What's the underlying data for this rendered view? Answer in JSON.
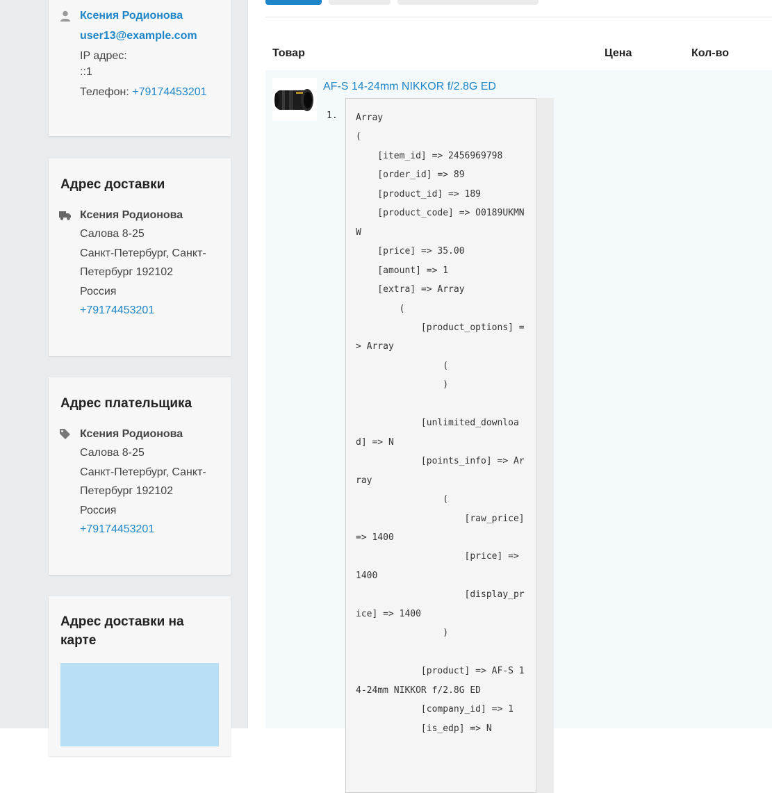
{
  "colors": {
    "accent": "#1e86c8",
    "sidebar_bg": "#e9ecef",
    "card_bg": "#f7f7f7",
    "map_bg": "#b9dff6"
  },
  "customer": {
    "name": "Ксения Родионова",
    "email": "user13@example.com",
    "ip_label": "IP адрес:",
    "ip_value": "::1",
    "phone_label": "Телефон:",
    "phone_value": "+79174453201",
    "icon": "user-icon"
  },
  "shipping": {
    "title": "Адрес доставки",
    "icon": "truck-icon",
    "name": "Ксения Родионова",
    "street": "Салова 8-25",
    "city_line1": "Санкт-Петербург, Санкт-",
    "city_line2": "Петербург 192102",
    "country": "Россия",
    "phone": "+79174453201"
  },
  "billing": {
    "title": "Адрес плательщика",
    "icon": "tag-icon",
    "name": "Ксения Родионова",
    "street": "Салова 8-25",
    "city_line1": "Санкт-Петербург, Санкт-",
    "city_line2": "Петербург 192102",
    "country": "Россия",
    "phone": "+79174453201"
  },
  "map_card": {
    "title_line1": "Адрес доставки на",
    "title_line2": "карте"
  },
  "table": {
    "col_product": "Товар",
    "col_price": "Цена",
    "col_qty": "Кол-во"
  },
  "product": {
    "name": "AF-S 14-24mm NIKKOR f/2.8G ED",
    "list_number": "1.",
    "debug_dump": "Array\n(\n    [item_id] => 2456969798\n    [order_id] => 89\n    [product_id] => 189\n    [product_code] => O0189UKMN\nW\n    [price] => 35.00\n    [amount] => 1\n    [extra] => Array\n        (\n            [product_options] =\n> Array\n                (\n                )\n\n            [unlimited_downloa\nd] => N\n            [points_info] => Ar\nray\n                (\n                    [raw_price]\n=> 1400\n                    [price] =>\n1400\n                    [display_pr\nice] => 1400\n                )\n\n            [product] => AF-S 1\n4-24mm NIKKOR f/2.8G ED\n            [company_id] => 1\n            [is_edp] => N"
  }
}
